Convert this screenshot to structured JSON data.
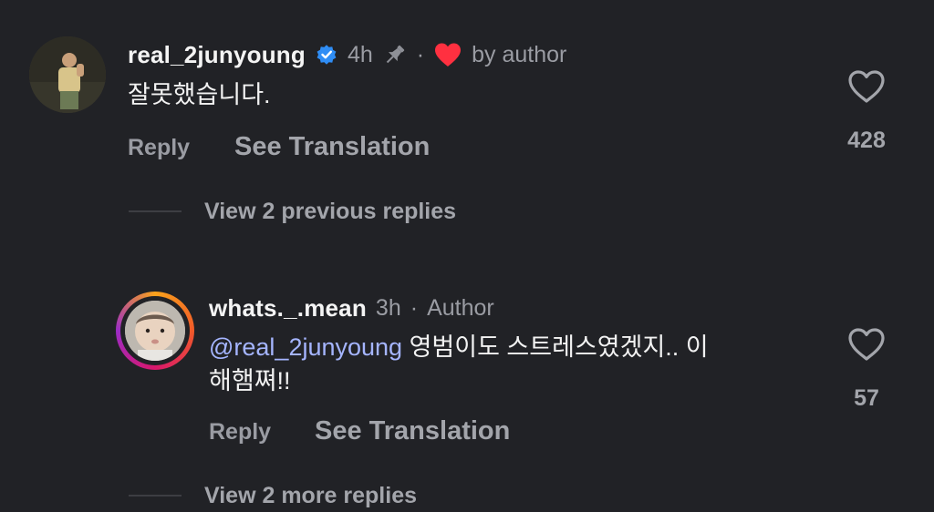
{
  "comment1": {
    "username": "real_2junyoung",
    "time": "4h",
    "separator": "·",
    "liked_by": "by author",
    "text": "잘못했습니다.",
    "reply_label": "Reply",
    "translate_label": "See Translation",
    "likes": "428",
    "view_replies": "View 2 previous replies"
  },
  "comment2": {
    "username": "whats._.mean",
    "time": "3h",
    "separator": "·",
    "role": "Author",
    "mention": "@real_2junyoung",
    "text_line1": " 영범이도 스트레스였겠지.. 이",
    "text_line2": "해햄쪄!!",
    "reply_label": "Reply",
    "translate_label": "See Translation",
    "likes": "57",
    "view_replies": "View 2 more replies"
  },
  "colors": {
    "background": "#212226",
    "verified": "#2f8df5",
    "author_heart": "#ff3040",
    "mention": "#a5b5ff"
  }
}
